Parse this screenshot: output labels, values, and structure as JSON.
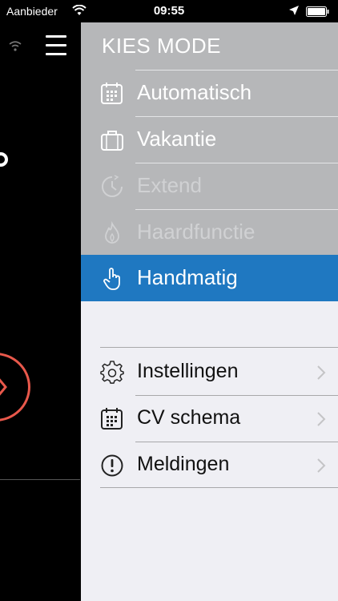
{
  "status_bar": {
    "carrier": "Aanbieder",
    "time": "09:55"
  },
  "drawer": {
    "mode_title": "KIES MODE",
    "modes": [
      {
        "label": "Automatisch",
        "icon": "calendar-icon",
        "state": "normal"
      },
      {
        "label": "Vakantie",
        "icon": "suitcase-icon",
        "state": "normal"
      },
      {
        "label": "Extend",
        "icon": "clock-icon",
        "state": "disabled"
      },
      {
        "label": "Haardfunctie",
        "icon": "flame-icon",
        "state": "disabled"
      },
      {
        "label": "Handmatig",
        "icon": "hand-pointer-icon",
        "state": "active"
      }
    ],
    "settings": [
      {
        "label": "Instellingen",
        "icon": "gear-icon"
      },
      {
        "label": "CV schema",
        "icon": "calendar-icon"
      },
      {
        "label": "Meldingen",
        "icon": "alert-icon"
      }
    ]
  },
  "colors": {
    "active_mode": "#1f78c1",
    "mode_section_bg": "#b6b7b9",
    "drawer_bg": "#efeff4",
    "accent_ring": "#e8584b"
  }
}
